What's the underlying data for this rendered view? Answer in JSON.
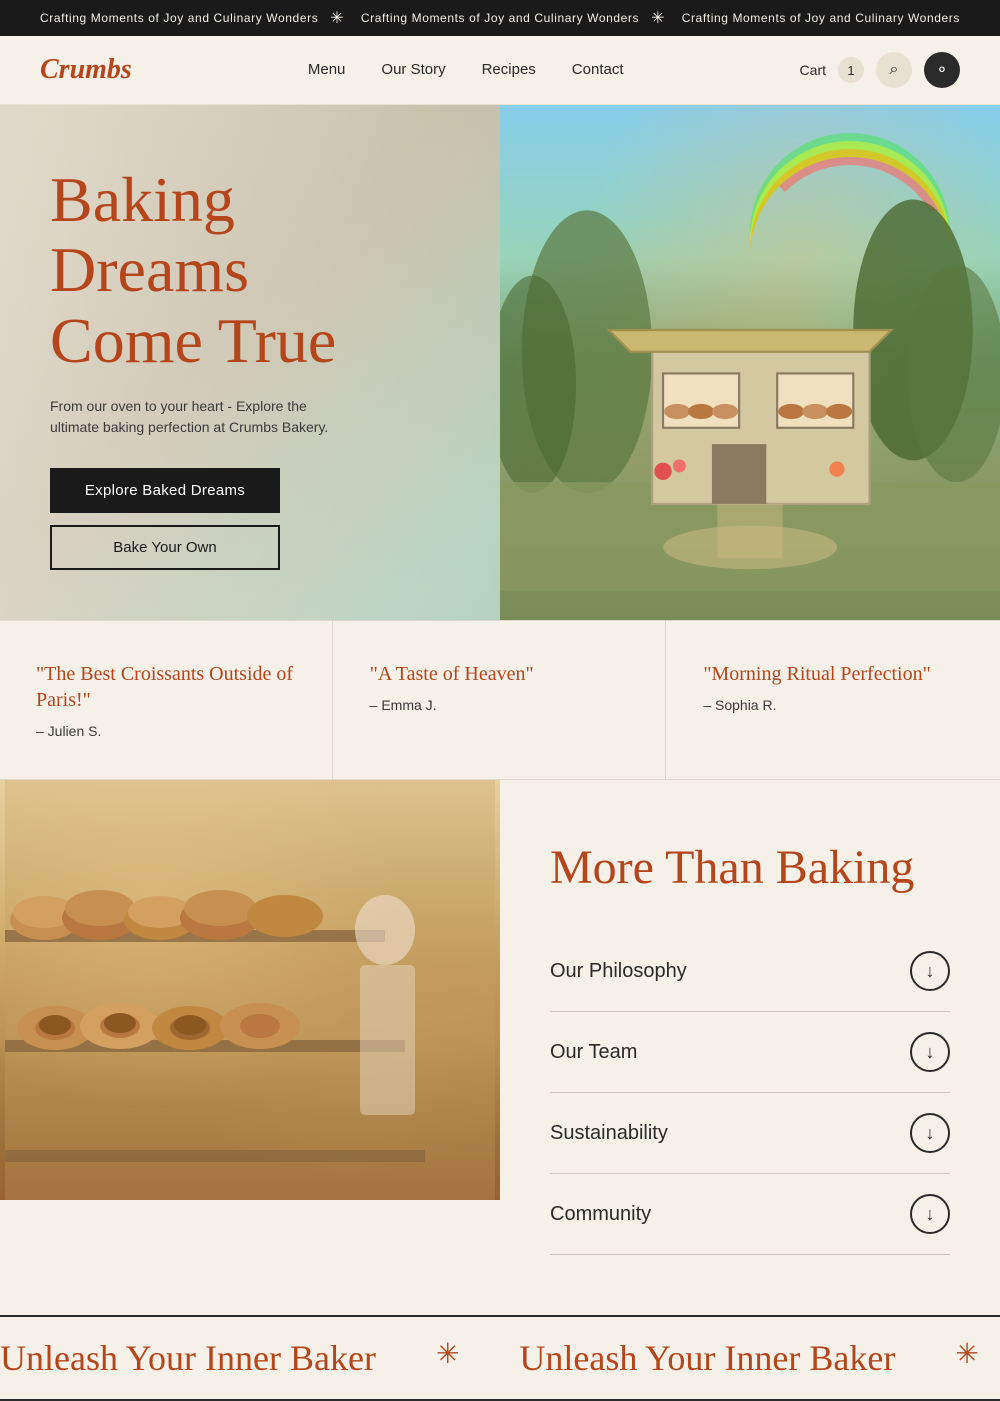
{
  "announcement": {
    "messages": [
      "Crafting Moments of Joy and Culinary Wonders",
      "Crafting Moments of Joy and Culinary Wonders",
      "Crafting Moments of Joy and Culinary Wonders"
    ]
  },
  "nav": {
    "logo": "Crumbs",
    "links": [
      {
        "label": "Menu",
        "href": "#"
      },
      {
        "label": "Our Story",
        "href": "#"
      },
      {
        "label": "Recipes",
        "href": "#"
      },
      {
        "label": "Contact",
        "href": "#"
      }
    ],
    "cart_label": "Cart",
    "cart_count": "1",
    "search_icon": "🔍",
    "account_icon": "👤"
  },
  "hero": {
    "title_line1": "Baking",
    "title_line2": "Dreams",
    "title_line3": "Come True",
    "subtitle": "From our oven to your heart - Explore the ultimate baking perfection at Crumbs Bakery.",
    "cta_primary": "Explore Baked Dreams",
    "cta_secondary": "Bake Your Own"
  },
  "testimonials": [
    {
      "quote": "\"The Best Croissants Outside of Paris!\"",
      "author": "– Julien S."
    },
    {
      "quote": "\"A Taste of Heaven\"",
      "author": "– Emma J."
    },
    {
      "quote": "\"Morning Ritual Perfection\"",
      "author": "– Sophia R."
    }
  ],
  "more_than_baking": {
    "section_title": "More Than Baking",
    "accordion_items": [
      {
        "label": "Our Philosophy"
      },
      {
        "label": "Our Team"
      },
      {
        "label": "Sustainability"
      },
      {
        "label": "Community"
      }
    ],
    "down_arrow": "↓"
  },
  "marquee": {
    "text": "Unleash Your Inner Baker",
    "star": "✳"
  }
}
